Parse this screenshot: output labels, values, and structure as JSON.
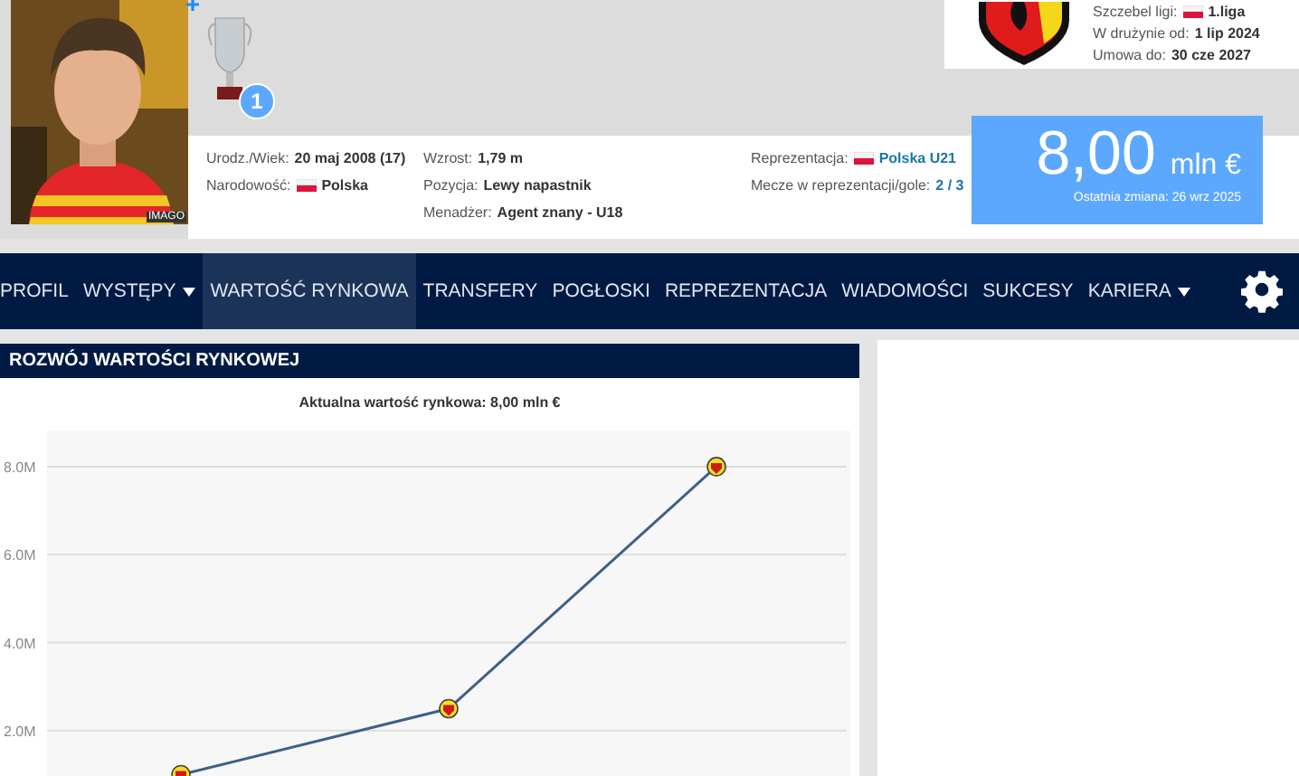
{
  "player": {
    "photo_credit": "IMAGO",
    "trophies": [
      {
        "count": "1"
      }
    ]
  },
  "club": {
    "details": [
      {
        "label": "Szczebel ligi:",
        "value": "1.liga",
        "flag": true
      },
      {
        "label": "W drużynie od:",
        "value": "1 lip 2024",
        "flag": false
      },
      {
        "label": "Umowa do:",
        "value": "30 cze 2027",
        "flag": false
      }
    ]
  },
  "info_columns": [
    [
      {
        "label": "Urodz./Wiek:",
        "value": "20 maj 2008 (17)",
        "flag": false,
        "link": false
      },
      {
        "label": "Narodowość:",
        "value": "Polska",
        "flag": true,
        "link": false
      }
    ],
    [
      {
        "label": "Wzrost:",
        "value": "1,79 m",
        "flag": false,
        "link": false
      },
      {
        "label": "Pozycja:",
        "value": "Lewy napastnik",
        "flag": false,
        "link": false
      },
      {
        "label": "Menadżer:",
        "value": "Agent znany - U18",
        "flag": false,
        "link": false
      }
    ],
    [
      {
        "label": "Reprezentacja:",
        "value": "Polska U21",
        "flag": true,
        "link": true
      },
      {
        "label": "Mecze w reprezentacji/gole:",
        "value": "2 / 3",
        "flag": false,
        "link": true
      }
    ]
  ],
  "market_value": {
    "amount": "8,00",
    "unit": "mln €",
    "last_change": "Ostatnia zmiana: 26 wrz 2025"
  },
  "nav": {
    "tabs": [
      {
        "label": "PROFIL",
        "selected": false,
        "dropdown": false
      },
      {
        "label": "WYSTĘPY",
        "selected": false,
        "dropdown": true
      },
      {
        "label": "WARTOŚĆ RYNKOWA",
        "selected": true,
        "dropdown": false
      },
      {
        "label": "TRANSFERY",
        "selected": false,
        "dropdown": false
      },
      {
        "label": "POGŁOSKI",
        "selected": false,
        "dropdown": false
      },
      {
        "label": "REPREZENTACJA",
        "selected": false,
        "dropdown": false
      },
      {
        "label": "WIADOMOŚCI",
        "selected": false,
        "dropdown": false
      },
      {
        "label": "SUKCESY",
        "selected": false,
        "dropdown": false
      },
      {
        "label": "KARIERA",
        "selected": false,
        "dropdown": true
      }
    ]
  },
  "section": {
    "title": "ROZWÓJ WARTOŚCI RYNKOWEJ",
    "chart_data": {
      "type": "line",
      "title": "Aktualna wartość rynkowa: 8,00 mln €",
      "categories": [
        null,
        null,
        null
      ],
      "series": [
        {
          "color": "#3f5f88",
          "marker": true,
          "values": [
            1.0,
            2.5,
            8.0
          ]
        }
      ],
      "ylim": [
        0.23,
        8.82
      ],
      "grid": true,
      "yticks": [
        {
          "value": 2,
          "label": "2.0M"
        },
        {
          "value": 4,
          "label": "4.0M"
        },
        {
          "value": 6,
          "label": "6.0M"
        },
        {
          "value": 8,
          "label": "8.0M"
        }
      ]
    }
  }
}
